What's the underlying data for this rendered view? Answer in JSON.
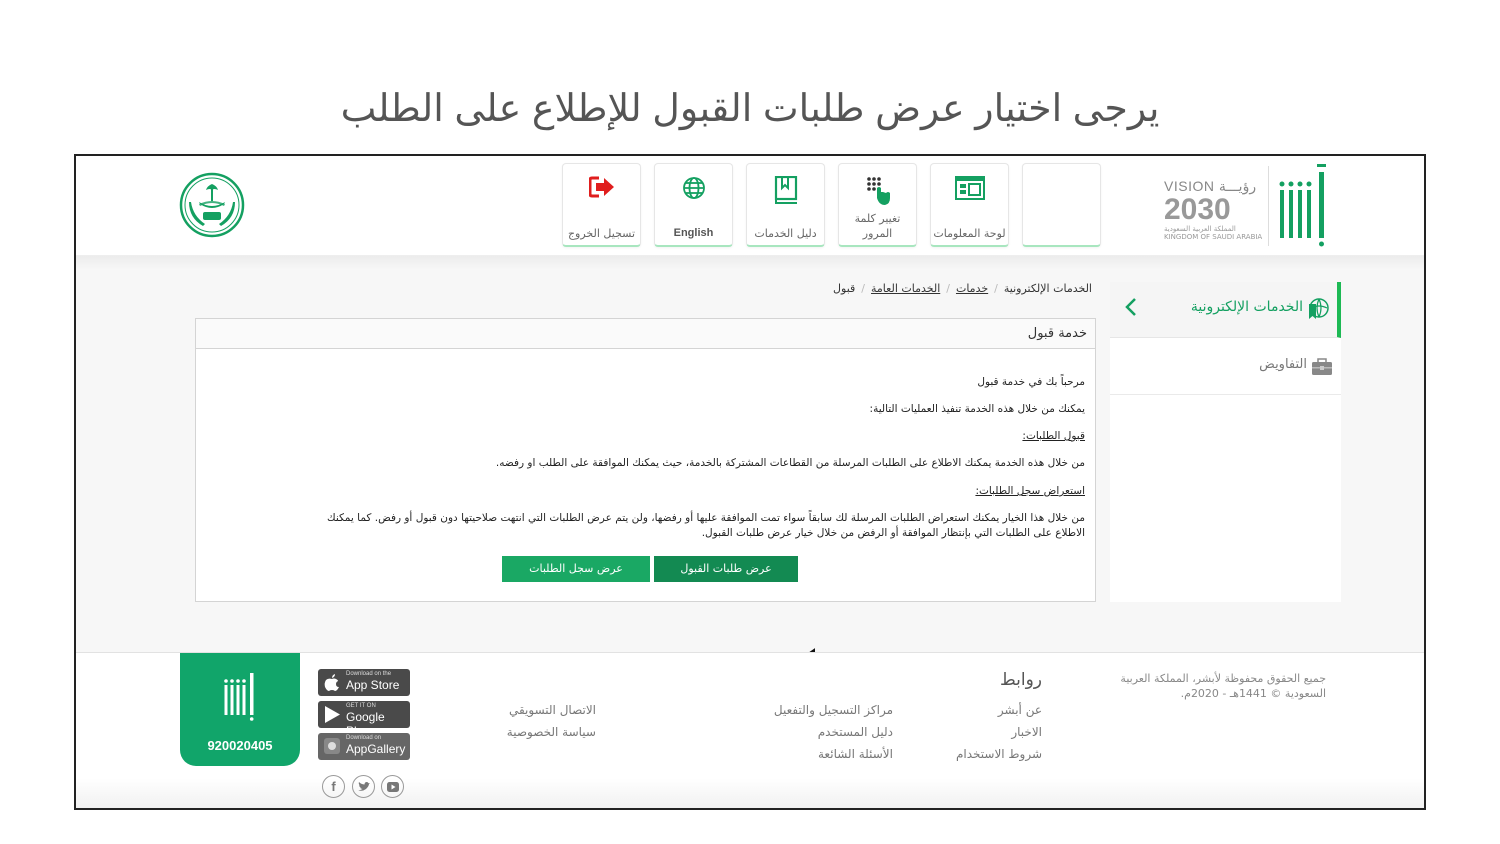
{
  "slide_title": "يرجى اختيار عرض طلبات القبول للإطلاع على الطلب",
  "header": {
    "vision": {
      "line1": "VISION رؤيـــة",
      "line2": "2030",
      "line3": "المملكة العربية السعودية",
      "line4": "KINGDOM OF SAUDI ARABIA"
    },
    "tiles": [
      {
        "name": "blank",
        "label": ""
      },
      {
        "name": "dashboard",
        "label": "لوحة المعلومات",
        "icon": "dashboard-icon"
      },
      {
        "name": "change-password",
        "label": "تغيير كلمة المرور",
        "icon": "keypad-hand-icon"
      },
      {
        "name": "services-guide",
        "label": "دليل الخدمات",
        "icon": "book-icon"
      },
      {
        "name": "english",
        "label": "English",
        "icon": "globe-icon"
      },
      {
        "name": "logout",
        "label": "تسجيل الخروج",
        "icon": "logout-icon"
      }
    ]
  },
  "sidebar": {
    "items": [
      {
        "label": "الخدمات الإلكترونية",
        "active": true,
        "icon": "globe-bookmark-icon"
      },
      {
        "label": "التفاويض",
        "active": false,
        "icon": "briefcase-icon"
      }
    ]
  },
  "breadcrumb": [
    {
      "label": "الخدمات الإلكترونية",
      "link": false
    },
    {
      "label": "خدمات",
      "link": true
    },
    {
      "label": "الخدمات العامة",
      "link": true
    },
    {
      "label": "قبول",
      "link": false
    }
  ],
  "panel": {
    "title": "خدمة قبول",
    "welcome": "مرحباً بك في خدمة قبول",
    "intro": "يمكنك من خلال هذه الخدمة تنفيذ العمليات التالية:",
    "section1_title": "قبول الطلبات:",
    "section1_text": "من خلال هذه الخدمة يمكنك الاطلاع على الطلبات المرسلة من القطاعات المشتركة بالخدمة، حيث يمكنك الموافقة على الطلب او رفضه.",
    "section2_title": "استعراض سجل الطلبات:",
    "section2_text_line1": "من خلال هذا الخيار يمكنك استعراض الطلبات المرسلة لك سابقاً سواء تمت الموافقة عليها أو رفضها، ولن يتم عرض الطلبات التي انتهت صلاحيتها دون قبول أو رفض. كما يمكنك",
    "section2_text_line2": "الاطلاع على الطلبات التي بإنتظار الموافقة أو الرفض من خلال خيار عرض طلبات القبول.",
    "buttons": {
      "view_accept_requests": "عرض طلبات القبول",
      "view_requests_log": "عرض سجل الطلبات"
    }
  },
  "annotation": {
    "arrow_color": "#e06666",
    "points_to": "view_accept_requests"
  },
  "footer": {
    "copyright": "جميع الحقوق محفوظة لأبشر، المملكة العربية السعودية © 1441هـ - 2020م.",
    "links_title": "روابط",
    "col1": [
      "عن أبشر",
      "الاخبار",
      "شروط الاستخدام"
    ],
    "col2": [
      "مراكز التسجيل والتفعيل",
      "دليل المستخدم",
      "الأسئلة الشائعة"
    ],
    "col3": [
      "الاتصال التسويقي",
      "سياسة الخصوصية"
    ],
    "phone": "920020405",
    "stores": [
      {
        "small": "Download on the",
        "big": "App Store"
      },
      {
        "small": "GET IT ON",
        "big": "Google Play"
      },
      {
        "small": "Download on",
        "big": "AppGallery"
      }
    ],
    "social": [
      "facebook",
      "twitter",
      "youtube"
    ]
  },
  "colors": {
    "brand_green": "#11a56a",
    "button_dark": "#138a52",
    "button_light": "#1aa864",
    "logout_red": "#e01e1e"
  }
}
